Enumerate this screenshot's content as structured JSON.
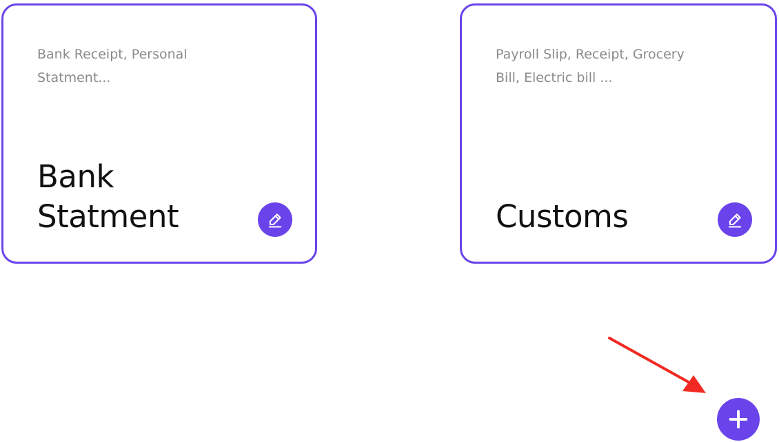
{
  "cards": [
    {
      "description": "Bank Receipt, Personal Statment...",
      "title": "Bank Statment",
      "edit_icon": "pencil-edit-icon"
    },
    {
      "description": "Payroll Slip, Receipt, Grocery Bill, Electric bill ...",
      "title": "Customs",
      "edit_icon": "pencil-edit-icon"
    }
  ],
  "fab": {
    "icon": "plus-icon"
  },
  "annotation": {
    "icon": "red-arrow-icon"
  },
  "colors": {
    "accent": "#6a44ea",
    "title_text": "#111111",
    "description_text": "#8a8a8a",
    "annotation_arrow": "#f02a22",
    "background": "#ffffff"
  }
}
